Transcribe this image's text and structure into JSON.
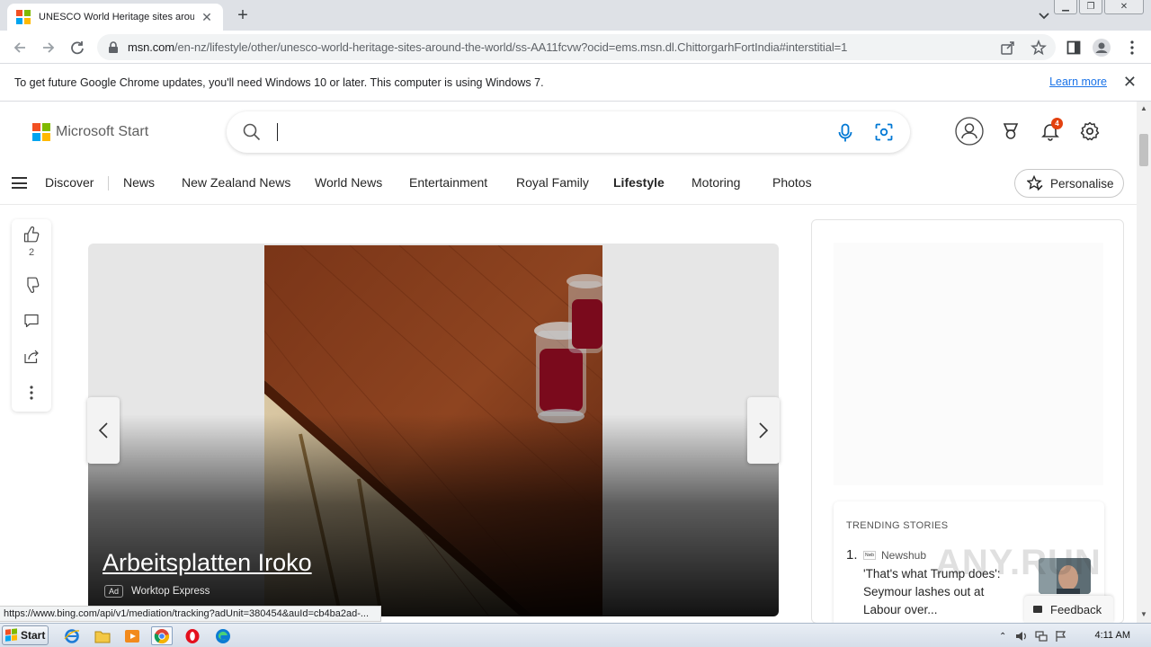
{
  "browser": {
    "tab": {
      "title": "UNESCO World Heritage sites around the world"
    },
    "url": {
      "host": "msn.com",
      "path": "/en-nz/lifestyle/other/unesco-world-heritage-sites-around-the-world/ss-AA11fcvw?ocid=ems.msn.dl.ChittorgarhFortIndia#interstitial=1"
    },
    "infobar": {
      "message": "To get future Google Chrome updates, you'll need Windows 10 or later. This computer is using Windows 7.",
      "learn_more": "Learn more"
    },
    "status_url": "https://www.bing.com/api/v1/mediation/tracking?adUnit=380454&auId=cb4ba2ad-..."
  },
  "msn": {
    "brand": "Microsoft Start",
    "notification_count": "4",
    "nav": {
      "items": [
        "Discover",
        "News",
        "New Zealand News",
        "World News",
        "Entertainment",
        "Royal Family",
        "Lifestyle",
        "Motoring",
        "Photos"
      ],
      "active": "Lifestyle",
      "personalise": "Personalise"
    },
    "rail": {
      "like_count": "2"
    },
    "slide": {
      "caption": "Arbeitsplatten Iroko",
      "ad_label": "Ad",
      "advertiser": "Worktop Express"
    },
    "trending": {
      "header": "TRENDING STORIES",
      "items": [
        {
          "rank": "1.",
          "source": "Newshub",
          "source_logo": "Nwb",
          "headline": "'That's what Trump does': Seymour lashes out at Labour over..."
        }
      ]
    },
    "feedback": "Feedback"
  },
  "watermark": "ANY.RUN",
  "taskbar": {
    "start": "Start",
    "clock": "4:11 AM"
  },
  "colors": {
    "ms_red": "#f25022",
    "ms_green": "#7fba00",
    "ms_blue": "#00a4ef",
    "ms_yellow": "#ffb900",
    "badge": "#e3410f",
    "link": "#1a73e8",
    "mic_blue": "#0078d4"
  },
  "icons": [
    "search-icon",
    "microphone-icon",
    "visual-search-icon",
    "profile-icon",
    "rewards-icon",
    "bell-icon",
    "gear-icon",
    "thumbs-up-icon",
    "thumbs-down-icon",
    "comment-icon",
    "share-icon",
    "more-icon",
    "chevron-left-icon",
    "chevron-right-icon",
    "star-edit-icon"
  ]
}
